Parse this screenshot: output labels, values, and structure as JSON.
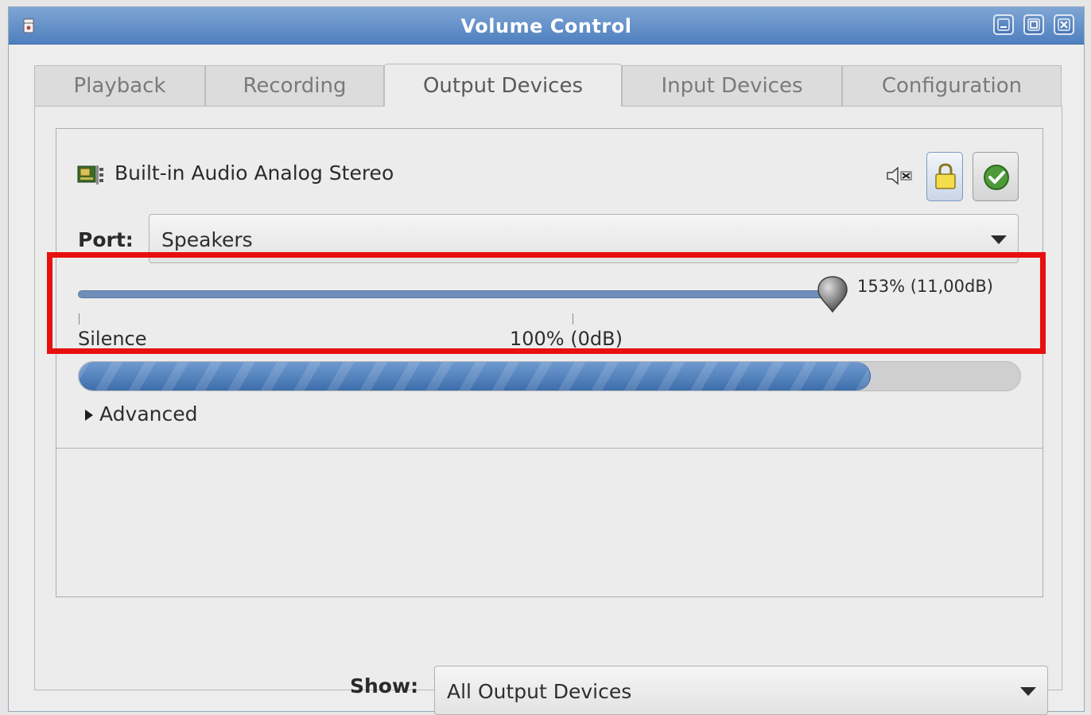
{
  "window": {
    "title": "Volume Control"
  },
  "tabs": [
    {
      "label": "Playback"
    },
    {
      "label": "Recording"
    },
    {
      "label": "Output Devices",
      "active": true
    },
    {
      "label": "Input Devices"
    },
    {
      "label": "Configuration"
    }
  ],
  "device": {
    "name": "Built-in Audio Analog Stereo",
    "port_label": "Port:",
    "port_value": "Speakers",
    "volume_text": "153% (11,00dB)",
    "volume_percent": 153,
    "mark_silence": "Silence",
    "mark_100": "100% (0dB)",
    "level_fraction": 0.84,
    "advanced_label": "Advanced"
  },
  "show": {
    "label": "Show:",
    "value": "All Output Devices"
  },
  "colors": {
    "titlebar": "#4f7fbf",
    "highlight": "#e8100f",
    "level": "#4a7bba"
  }
}
